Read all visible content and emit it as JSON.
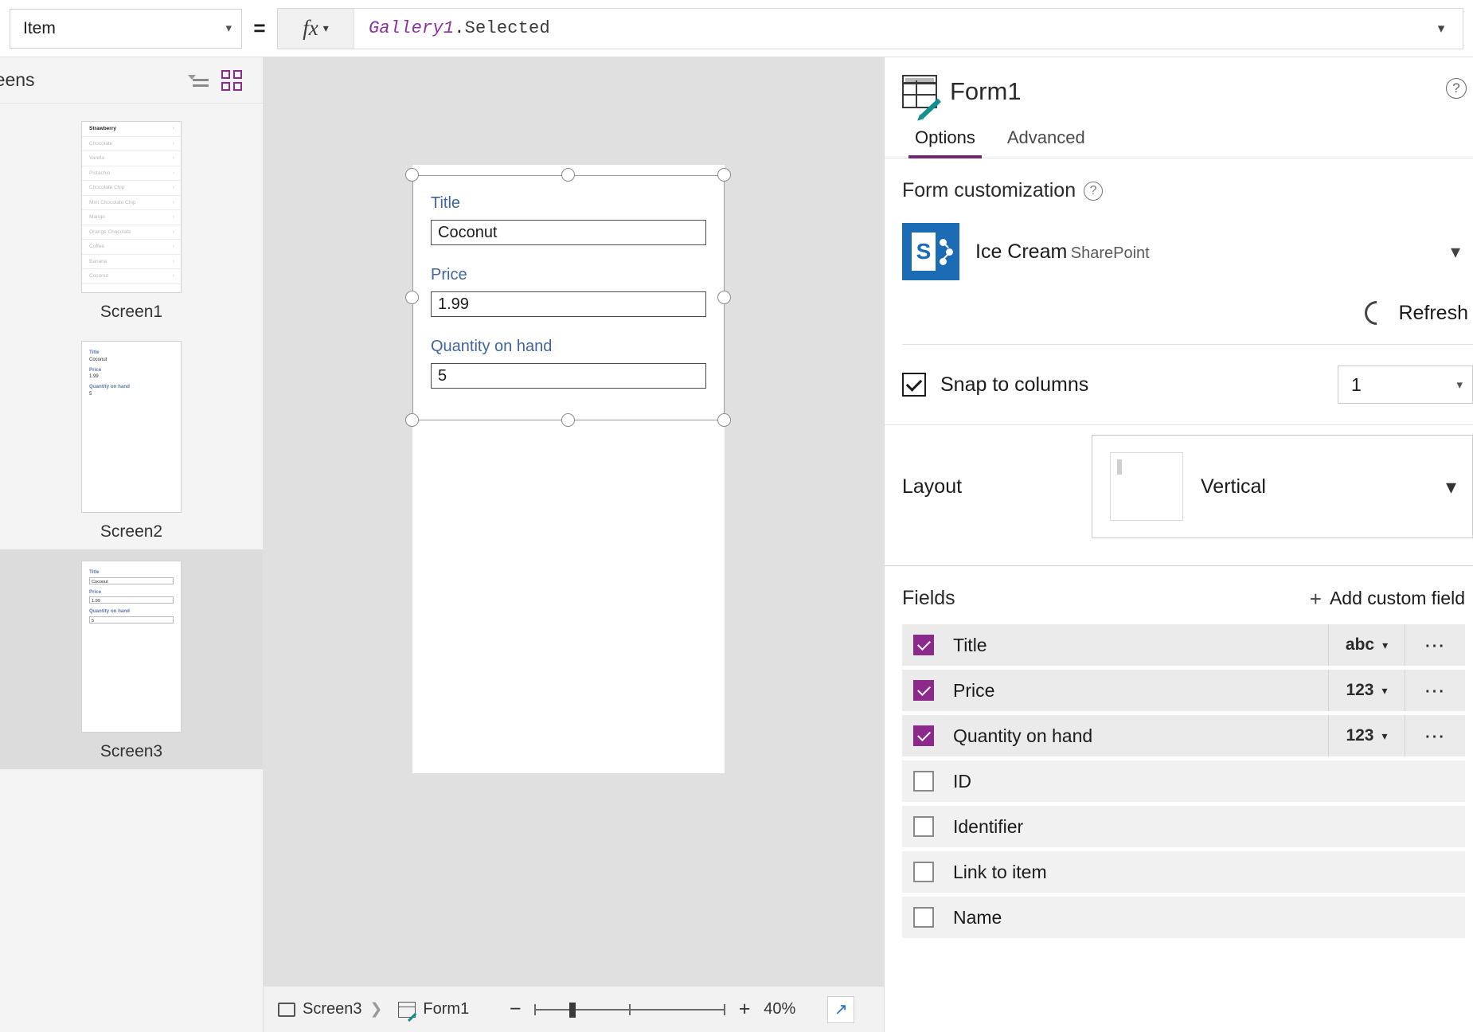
{
  "formula_bar": {
    "property": "Item",
    "equals": "=",
    "fx_label": "fx",
    "formula_object": "Gallery1",
    "formula_dot": ".",
    "formula_property": "Selected"
  },
  "sidebar": {
    "title": "reens",
    "screens": [
      {
        "label": "Screen1",
        "type": "gallery",
        "selected": false,
        "items": [
          "Strawberry",
          "Chocolate",
          "Vanilla",
          "Pistachio",
          "Chocolate Chip",
          "Mint Chocolate Chip",
          "Mango",
          "Orange Chocolate",
          "Coffee",
          "Banana",
          "Coconut"
        ]
      },
      {
        "label": "Screen2",
        "type": "display-form",
        "selected": false,
        "fields": [
          {
            "label": "Title",
            "value": "Coconut"
          },
          {
            "label": "Price",
            "value": "1.99"
          },
          {
            "label": "Quantity on hand",
            "value": "5"
          }
        ]
      },
      {
        "label": "Screen3",
        "type": "edit-form",
        "selected": true,
        "fields": [
          {
            "label": "Title",
            "value": "Coconut"
          },
          {
            "label": "Price",
            "value": "1.99"
          },
          {
            "label": "Quantity on hand",
            "value": "5"
          }
        ]
      }
    ]
  },
  "canvas": {
    "form_fields": [
      {
        "label": "Title",
        "value": "Coconut"
      },
      {
        "label": "Price",
        "value": "1.99"
      },
      {
        "label": "Quantity on hand",
        "value": "5"
      }
    ]
  },
  "bottom_bar": {
    "breadcrumb_screen": "Screen3",
    "breadcrumb_control": "Form1",
    "zoom_out": "−",
    "zoom_in": "+",
    "zoom_level": "40%"
  },
  "right_panel": {
    "title": "Form1",
    "tabs": [
      {
        "label": "Options",
        "active": true
      },
      {
        "label": "Advanced",
        "active": false
      }
    ],
    "form_customization": {
      "section_title": "Form customization",
      "data_source_name": "Ice Cream",
      "data_source_kind": "SharePoint",
      "refresh_label": "Refresh"
    },
    "snap": {
      "label": "Snap to columns",
      "checked": true,
      "columns": "1"
    },
    "layout": {
      "label": "Layout",
      "value": "Vertical"
    },
    "fields": {
      "title": "Fields",
      "add_label": "Add custom field",
      "rows": [
        {
          "name": "Title",
          "checked": true,
          "type": "abc"
        },
        {
          "name": "Price",
          "checked": true,
          "type": "123"
        },
        {
          "name": "Quantity on hand",
          "checked": true,
          "type": "123"
        },
        {
          "name": "ID",
          "checked": false,
          "type": ""
        },
        {
          "name": "Identifier",
          "checked": false,
          "type": ""
        },
        {
          "name": "Link to item",
          "checked": false,
          "type": ""
        },
        {
          "name": "Name",
          "checked": false,
          "type": ""
        }
      ]
    }
  },
  "colors": {
    "accent_purple": "#742774",
    "check_purple": "#8b2a8b",
    "field_label_blue": "#41649e",
    "sharepoint_blue": "#1b6bb5",
    "formula_object": "#8c2fa0"
  }
}
